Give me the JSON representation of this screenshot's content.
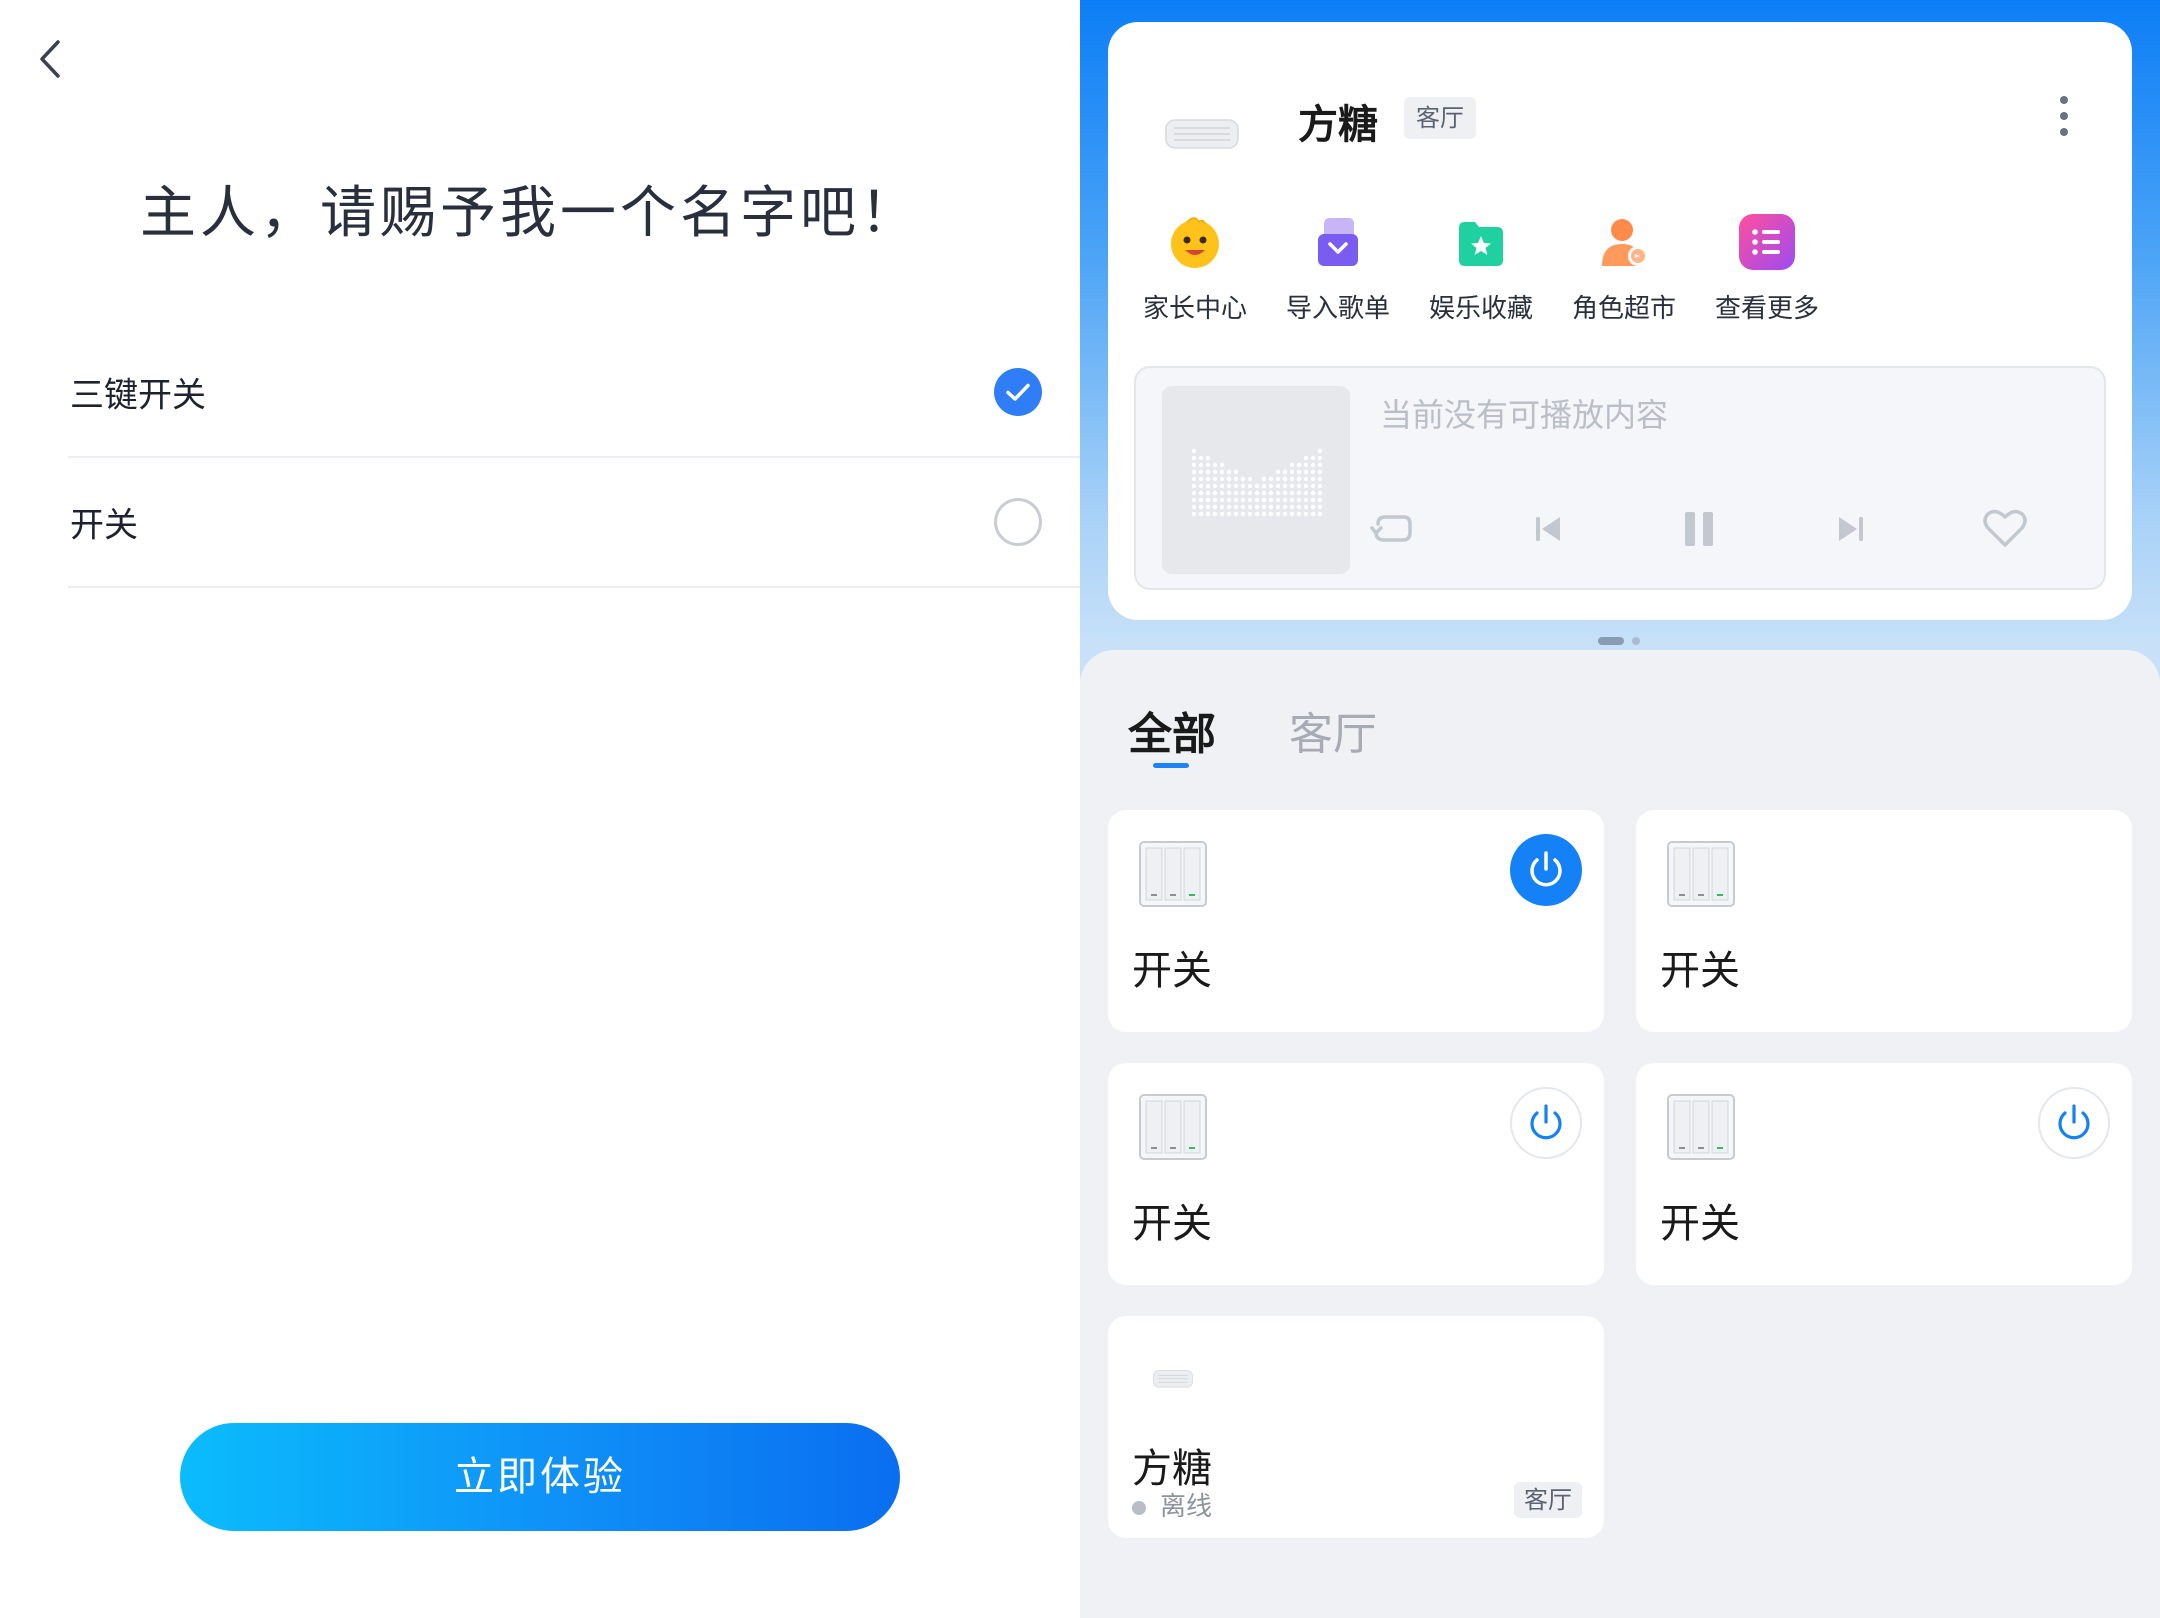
{
  "left": {
    "title": "主人，请赐予我一个名字吧！",
    "options": [
      {
        "label": "三键开关",
        "selected": true
      },
      {
        "label": "开关",
        "selected": false
      }
    ],
    "cta_label": "立即体验"
  },
  "right": {
    "device": {
      "name": "方糖",
      "room": "客厅"
    },
    "quick_actions": [
      {
        "label": "家长中心",
        "icon": "kid-face-icon"
      },
      {
        "label": "导入歌单",
        "icon": "import-playlist-icon"
      },
      {
        "label": "娱乐收藏",
        "icon": "star-folder-icon"
      },
      {
        "label": "角色超市",
        "icon": "character-market-icon"
      },
      {
        "label": "查看更多",
        "icon": "list-more-icon"
      }
    ],
    "player": {
      "empty_text": "当前没有可播放内容"
    },
    "tabs": [
      {
        "label": "全部",
        "active": true
      },
      {
        "label": "客厅",
        "active": false
      }
    ],
    "devices": [
      {
        "name": "开关",
        "power": "on"
      },
      {
        "name": "开关",
        "power": "none"
      },
      {
        "name": "开关",
        "power": "off"
      },
      {
        "name": "开关",
        "power": "off"
      },
      {
        "name": "方糖",
        "status": "离线",
        "room": "客厅"
      }
    ]
  },
  "colors": {
    "accent": "#1481f6",
    "check": "#2f7ef7",
    "cta_start": "#0bbcfc",
    "cta_end": "#0a6ef0"
  }
}
